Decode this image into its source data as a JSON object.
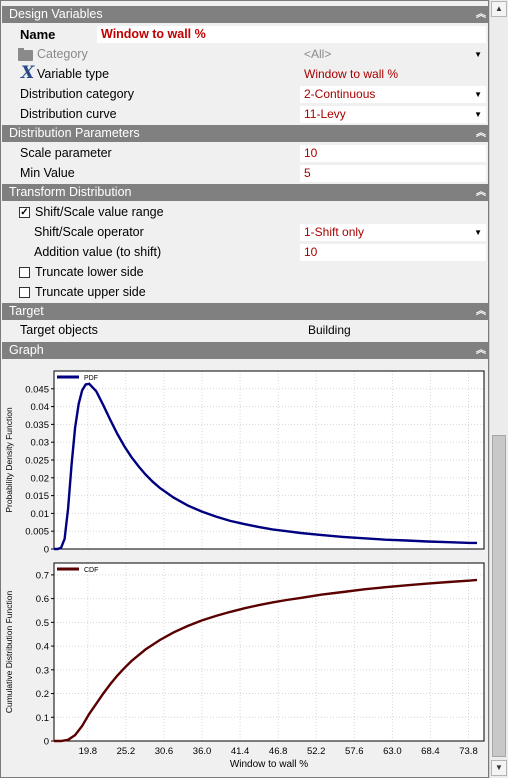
{
  "sections": {
    "design_variables": "Design Variables",
    "distribution_parameters": "Distribution Parameters",
    "transform_distribution": "Transform Distribution",
    "target": "Target",
    "graph": "Graph"
  },
  "name_row": {
    "label": "Name",
    "value": "Window to wall %"
  },
  "category_row": {
    "label": "Category",
    "value": "<All>"
  },
  "variable_type_row": {
    "label": "Variable type",
    "value": "Window to wall %"
  },
  "distribution_category_row": {
    "label": "Distribution category",
    "value": "2-Continuous"
  },
  "distribution_curve_row": {
    "label": "Distribution curve",
    "value": "11-Levy"
  },
  "scale_parameter_row": {
    "label": "Scale parameter",
    "value": "10"
  },
  "min_value_row": {
    "label": "Min Value",
    "value": "5"
  },
  "shift_scale_range": {
    "label": "Shift/Scale value range",
    "checked": true
  },
  "shift_scale_operator_row": {
    "label": "Shift/Scale operator",
    "value": "1-Shift only"
  },
  "addition_value_row": {
    "label": "Addition value (to shift)",
    "value": "10"
  },
  "truncate_lower": {
    "label": "Truncate lower side",
    "checked": false
  },
  "truncate_upper": {
    "label": "Truncate upper side",
    "checked": false
  },
  "target_objects_row": {
    "label": "Target objects",
    "value": "Building"
  },
  "icons": {
    "collapse": "double-chevron-up-icon",
    "dropdown": "triangle-down-icon",
    "folder": "folder-icon",
    "variable": "x-variable-icon"
  },
  "colors": {
    "section_header": "#808080",
    "value_text": "#a80000",
    "pdf_line": "#000080",
    "cdf_line": "#5a0000"
  },
  "chart_data": [
    {
      "type": "line",
      "title": "",
      "xlabel": "",
      "ylabel": "Probability Density Function",
      "legend": "top-left",
      "grid": true,
      "xlim": [
        15,
        76
      ],
      "ylim": [
        0,
        0.05
      ],
      "x_ticks": [],
      "y_ticks": [
        "0",
        "0.005",
        "0.01",
        "0.015",
        "0.02",
        "0.025",
        "0.03",
        "0.035",
        "0.04",
        "0.045"
      ],
      "series": [
        {
          "name": "PDF",
          "x": [
            15.0,
            15.5,
            16.0,
            16.5,
            17.0,
            17.5,
            18.0,
            18.5,
            19.0,
            19.5,
            20.0,
            21.0,
            22.0,
            23.0,
            24.0,
            25.0,
            26.0,
            27.0,
            28.0,
            29.0,
            30.0,
            32.0,
            34.0,
            36.0,
            38.0,
            40.0,
            42.0,
            44.0,
            46.0,
            48.0,
            50.0,
            53.0,
            56.0,
            59.0,
            62.0,
            65.0,
            68.0,
            71.0,
            74.0,
            75.0
          ],
          "y": [
            0.0,
            0.0,
            0.0003,
            0.0028,
            0.0114,
            0.0238,
            0.0341,
            0.0408,
            0.0446,
            0.0462,
            0.0464,
            0.0443,
            0.0404,
            0.0362,
            0.0323,
            0.0288,
            0.0258,
            0.0232,
            0.0209,
            0.0189,
            0.0172,
            0.0144,
            0.0122,
            0.0105,
            0.0091,
            0.0079,
            0.007,
            0.0062,
            0.0055,
            0.005,
            0.0045,
            0.0039,
            0.0034,
            0.003,
            0.0026,
            0.0024,
            0.0021,
            0.0019,
            0.0017,
            0.0017
          ]
        }
      ]
    },
    {
      "type": "line",
      "title": "",
      "xlabel": "Window to wall %",
      "ylabel": "Cumulative Distribution Function",
      "legend": "top-left",
      "grid": true,
      "xlim": [
        15,
        76
      ],
      "ylim": [
        0,
        0.75
      ],
      "x_ticks": [
        "19.8",
        "25.2",
        "30.6",
        "36.0",
        "41.4",
        "46.8",
        "52.2",
        "57.6",
        "63.0",
        "68.4",
        "73.8"
      ],
      "y_ticks": [
        "0",
        "0.1",
        "0.2",
        "0.3",
        "0.4",
        "0.5",
        "0.6",
        "0.7"
      ],
      "series": [
        {
          "name": "CDF",
          "x": [
            15.0,
            16.0,
            17.0,
            18.0,
            19.0,
            20.0,
            21.0,
            22.0,
            23.0,
            24.0,
            25.0,
            26.0,
            28.0,
            30.0,
            32.0,
            34.0,
            36.0,
            38.0,
            40.0,
            42.0,
            44.0,
            46.0,
            48.0,
            50.0,
            53.0,
            56.0,
            59.0,
            62.0,
            65.0,
            68.0,
            71.0,
            74.0,
            75.0
          ],
          "y": [
            0.0,
            0.0,
            0.005,
            0.025,
            0.064,
            0.114,
            0.157,
            0.2,
            0.24,
            0.276,
            0.308,
            0.337,
            0.386,
            0.425,
            0.458,
            0.485,
            0.508,
            0.527,
            0.544,
            0.559,
            0.572,
            0.584,
            0.594,
            0.603,
            0.617,
            0.628,
            0.639,
            0.648,
            0.656,
            0.663,
            0.67,
            0.676,
            0.679
          ]
        }
      ]
    }
  ]
}
